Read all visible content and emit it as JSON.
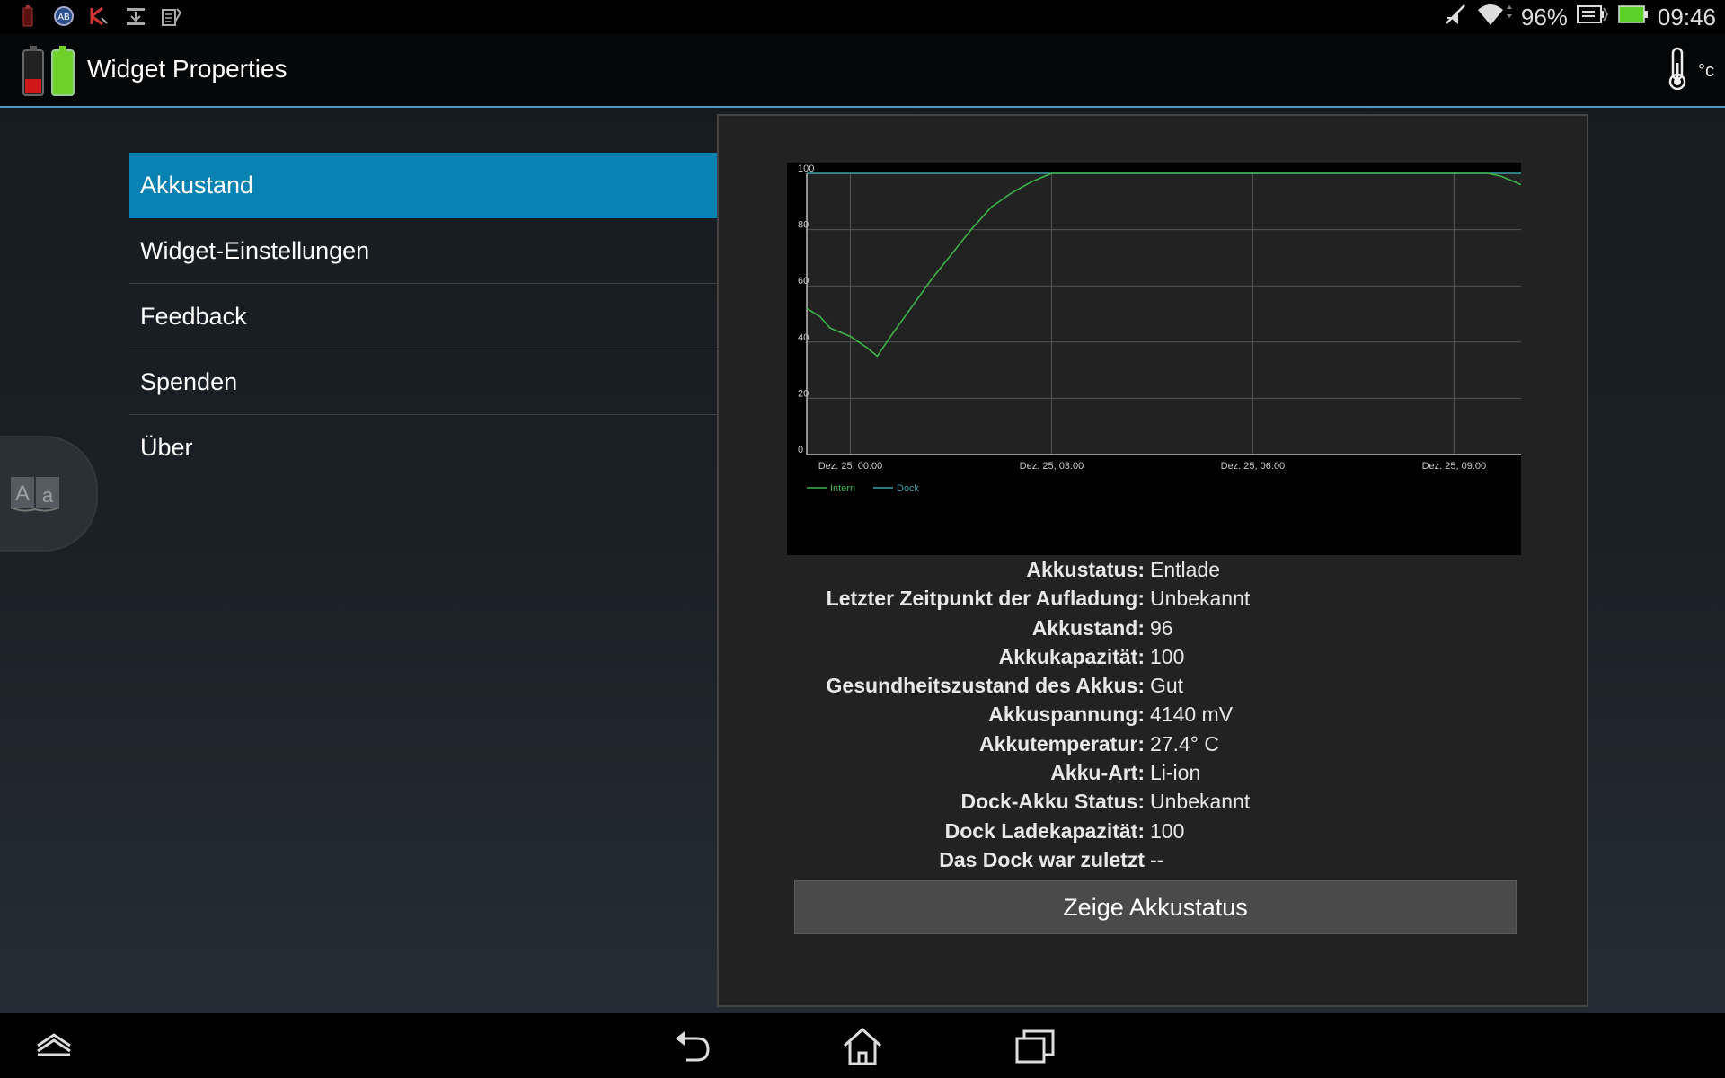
{
  "status_bar": {
    "battery_percent": "96%",
    "time": "09:46",
    "left_icons": [
      "battery-alert-icon",
      "dictionary-icon",
      "kaspersky-icon",
      "download-icon",
      "clipboard-icon"
    ],
    "right_icons": [
      "mute-icon",
      "wifi-icon",
      "battery-icon"
    ]
  },
  "action_bar": {
    "title": "Widget Properties",
    "temp_unit": "°c"
  },
  "menu": {
    "items": [
      {
        "label": "Akkustand"
      },
      {
        "label": "Widget-Einstellungen"
      },
      {
        "label": "Feedback"
      },
      {
        "label": "Spenden"
      },
      {
        "label": "Über"
      }
    ],
    "selected": "Akkustand"
  },
  "chart_data": {
    "type": "line",
    "title": "",
    "xlabel": "",
    "ylabel": "",
    "ylim": [
      0,
      100
    ],
    "yticks": [
      "0",
      "20",
      "40",
      "60",
      "80",
      "100"
    ],
    "xticks": [
      "Dez. 25, 00:00",
      "Dez. 25, 03:00",
      "Dez. 25, 06:00",
      "Dez. 25, 09:00"
    ],
    "xlim_hours": [
      -0.65,
      10.0
    ],
    "grid": true,
    "legend": "bottom-left",
    "series": [
      {
        "name": "Intern",
        "color": "#3cb44a",
        "x_hours": [
          -0.65,
          -0.45,
          -0.3,
          0.0,
          0.25,
          0.4,
          0.6,
          0.9,
          1.2,
          1.5,
          1.8,
          2.1,
          2.4,
          2.7,
          2.9,
          3.0,
          4.0,
          6.0,
          8.0,
          9.0,
          9.5,
          9.7,
          10.0
        ],
        "values": [
          52,
          49,
          45,
          42,
          38,
          35,
          42,
          52,
          62,
          71,
          80,
          88,
          93,
          97,
          99,
          100,
          100,
          100,
          100,
          100,
          100,
          99,
          96
        ]
      },
      {
        "name": "Dock",
        "color": "#3aa3a8",
        "x_hours": [
          -0.65,
          10.0
        ],
        "values": [
          100,
          100
        ]
      }
    ]
  },
  "battery_info": [
    {
      "label": "Akkustatus:",
      "value": "Entlade"
    },
    {
      "label": "Letzter Zeitpunkt der Aufladung:",
      "value": "Unbekannt"
    },
    {
      "label": "Akkustand:",
      "value": "96"
    },
    {
      "label": "Akkukapazität:",
      "value": "100"
    },
    {
      "label": "Gesundheitszustand des Akkus:",
      "value": "Gut"
    },
    {
      "label": "Akkuspannung:",
      "value": "4140 mV"
    },
    {
      "label": "Akkutemperatur:",
      "value": "27.4° C"
    },
    {
      "label": "Akku-Art:",
      "value": "Li-ion"
    },
    {
      "label": "Dock-Akku Status:",
      "value": "Unbekannt"
    },
    {
      "label": "Dock Ladekapazität:",
      "value": "100"
    },
    {
      "label": "Das Dock war zuletzt angeschlossen:",
      "value": "--"
    }
  ],
  "show_button": {
    "label": "Zeige Akkustatus"
  },
  "nav_bar": {
    "icons": [
      "collapse-icon",
      "back-icon",
      "home-icon",
      "recent-apps-icon"
    ]
  }
}
